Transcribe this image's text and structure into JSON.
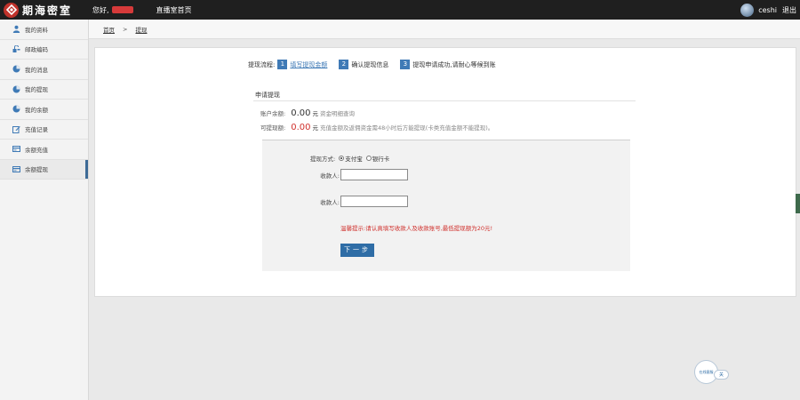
{
  "header": {
    "logo_text": "期海密室",
    "greeting": "您好,",
    "home_link": "直播室首页",
    "username": "ceshi",
    "logout": "退出"
  },
  "sidebar": {
    "items": [
      {
        "label": "我的资料",
        "icon": "user-icon"
      },
      {
        "label": "邮政编码",
        "icon": "key-icon"
      },
      {
        "label": "我的消息",
        "icon": "pie-chart-icon"
      },
      {
        "label": "我的提现",
        "icon": "pie-chart-icon"
      },
      {
        "label": "我的余额",
        "icon": "pie-chart-icon"
      },
      {
        "label": "充值记录",
        "icon": "edit-icon"
      },
      {
        "label": "余额充值",
        "icon": "card-icon"
      },
      {
        "label": "余额提现",
        "icon": "card-icon",
        "active": true
      }
    ]
  },
  "breadcrumb": {
    "home": "首页",
    "separator": ">",
    "current": "提现"
  },
  "steps": {
    "label": "提现流程:",
    "items": [
      {
        "num": "1",
        "text": "填写提现金额",
        "current": true
      },
      {
        "num": "2",
        "text": "确认提现信息",
        "current": false
      },
      {
        "num": "3",
        "text": "提现申请成功,请耐心等候到账",
        "current": false
      }
    ]
  },
  "section": {
    "title": "申请提现"
  },
  "balance": {
    "label": "账户余额:",
    "amount": "0.00",
    "unit": "元",
    "link": "资金明细查询"
  },
  "withdrawable": {
    "label": "可提现额:",
    "amount": "0.00",
    "unit": "元",
    "note": "充值金额及返佣资金需48小时后方能提现(卡类充值金额不能提现)。"
  },
  "form": {
    "method_label": "提现方式:",
    "method_options": [
      "支付宝",
      "银行卡"
    ],
    "selected_method": "支付宝",
    "fields": [
      {
        "label": "收款人:",
        "value": ""
      },
      {
        "label": "收款人:",
        "value": ""
      }
    ],
    "tip": "温馨提示:请认真填写收款人及收款账号,最低提现额为20元!",
    "next_button": "下一步"
  },
  "float_widget": {
    "badge_text": "在线客服",
    "tag_text": "关"
  },
  "colors": {
    "accent": "#2f6da6",
    "alert": "#d0312d",
    "topbar": "#1f1f1f"
  }
}
